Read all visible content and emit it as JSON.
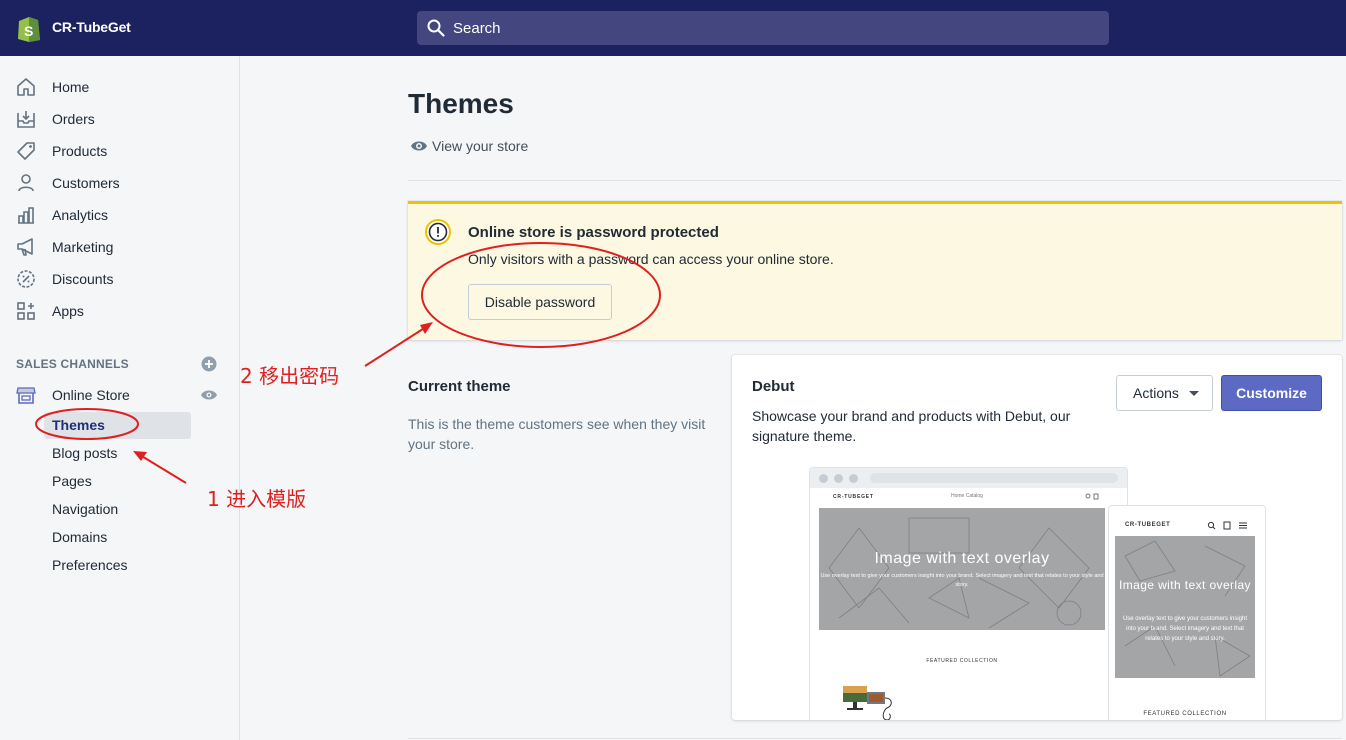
{
  "topbar": {
    "store_name": "CR-TubeGet",
    "search_placeholder": "Search"
  },
  "sidebar": {
    "items": [
      {
        "label": "Home",
        "icon": "home-icon"
      },
      {
        "label": "Orders",
        "icon": "orders-icon"
      },
      {
        "label": "Products",
        "icon": "tag-icon"
      },
      {
        "label": "Customers",
        "icon": "person-icon"
      },
      {
        "label": "Analytics",
        "icon": "bar-chart-icon"
      },
      {
        "label": "Marketing",
        "icon": "megaphone-icon"
      },
      {
        "label": "Discounts",
        "icon": "discount-icon"
      },
      {
        "label": "Apps",
        "icon": "apps-icon"
      }
    ],
    "sales_channels_title": "SALES CHANNELS",
    "online_store_label": "Online Store",
    "sub_items": [
      "Themes",
      "Blog posts",
      "Pages",
      "Navigation",
      "Domains",
      "Preferences"
    ],
    "active_sub_item": "Themes"
  },
  "main": {
    "title": "Themes",
    "view_store": "View your store",
    "banner": {
      "title": "Online store is password protected",
      "text": "Only visitors with a password can access your online store.",
      "button": "Disable password",
      "color": "#eec200"
    },
    "current_theme": {
      "title": "Current theme",
      "description": "This is the theme customers see when they visit your store."
    },
    "theme_card": {
      "name": "Debut",
      "description": "Showcase your brand and products with Debut, our signature theme.",
      "actions_label": "Actions",
      "customize_label": "Customize",
      "accent": "#5c6ac4"
    },
    "preview": {
      "brand": "CR-TUBEGET",
      "nav_links": "Home   Catalog",
      "hero_title": "Image with text overlay",
      "hero_sub": "Use overlay text to give your customers insight into your brand. Select imagery and text that relates to your style and story.",
      "featured": "FEATURED COLLECTION",
      "mobile_hero_title": "Image with text overlay",
      "mobile_hero_sub": "Use overlay text to give your customers insight into your brand. Select imagery and text that relates to your style and story."
    }
  },
  "annotations": {
    "step1": "1 进入模版",
    "step2": "2 移出密码",
    "color": "#e02020"
  }
}
